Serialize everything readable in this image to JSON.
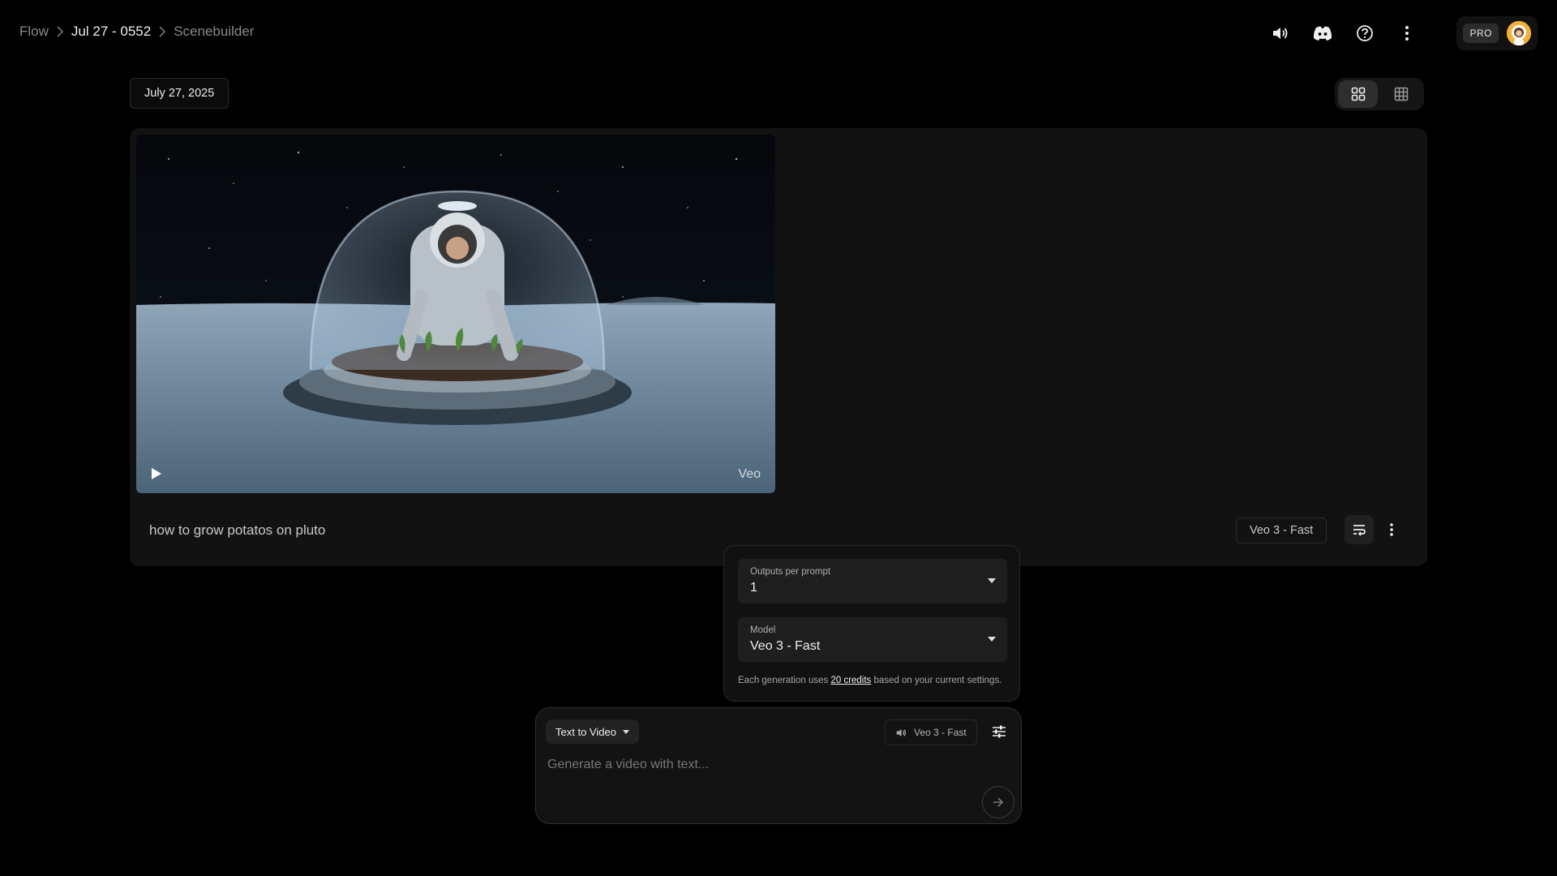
{
  "breadcrumb": {
    "items": [
      "Flow",
      "Jul 27 - 0552",
      "Scenebuilder"
    ]
  },
  "header": {
    "pro_label": "PRO",
    "icons": [
      "volume-icon",
      "discord-icon",
      "help-icon",
      "more-vert-icon"
    ]
  },
  "date_chip": "July 27, 2025",
  "view_toggle": {
    "selected": "grid-large"
  },
  "card": {
    "watermark": "Veo",
    "prompt": "how to grow potatos on pluto",
    "model": "Veo 3 - Fast"
  },
  "settings": {
    "outputs_label": "Outputs per prompt",
    "outputs_value": "1",
    "model_label": "Model",
    "model_value": "Veo 3 - Fast",
    "note_prefix": "Each generation uses ",
    "note_link": "20 credits",
    "note_suffix": " based on your current settings."
  },
  "composer": {
    "mode": "Text to Video",
    "model": "Veo 3 - Fast",
    "placeholder": "Generate a video with text..."
  },
  "colors": {
    "background": "#000000",
    "card": "#121212",
    "avatar": "#f2b233"
  }
}
